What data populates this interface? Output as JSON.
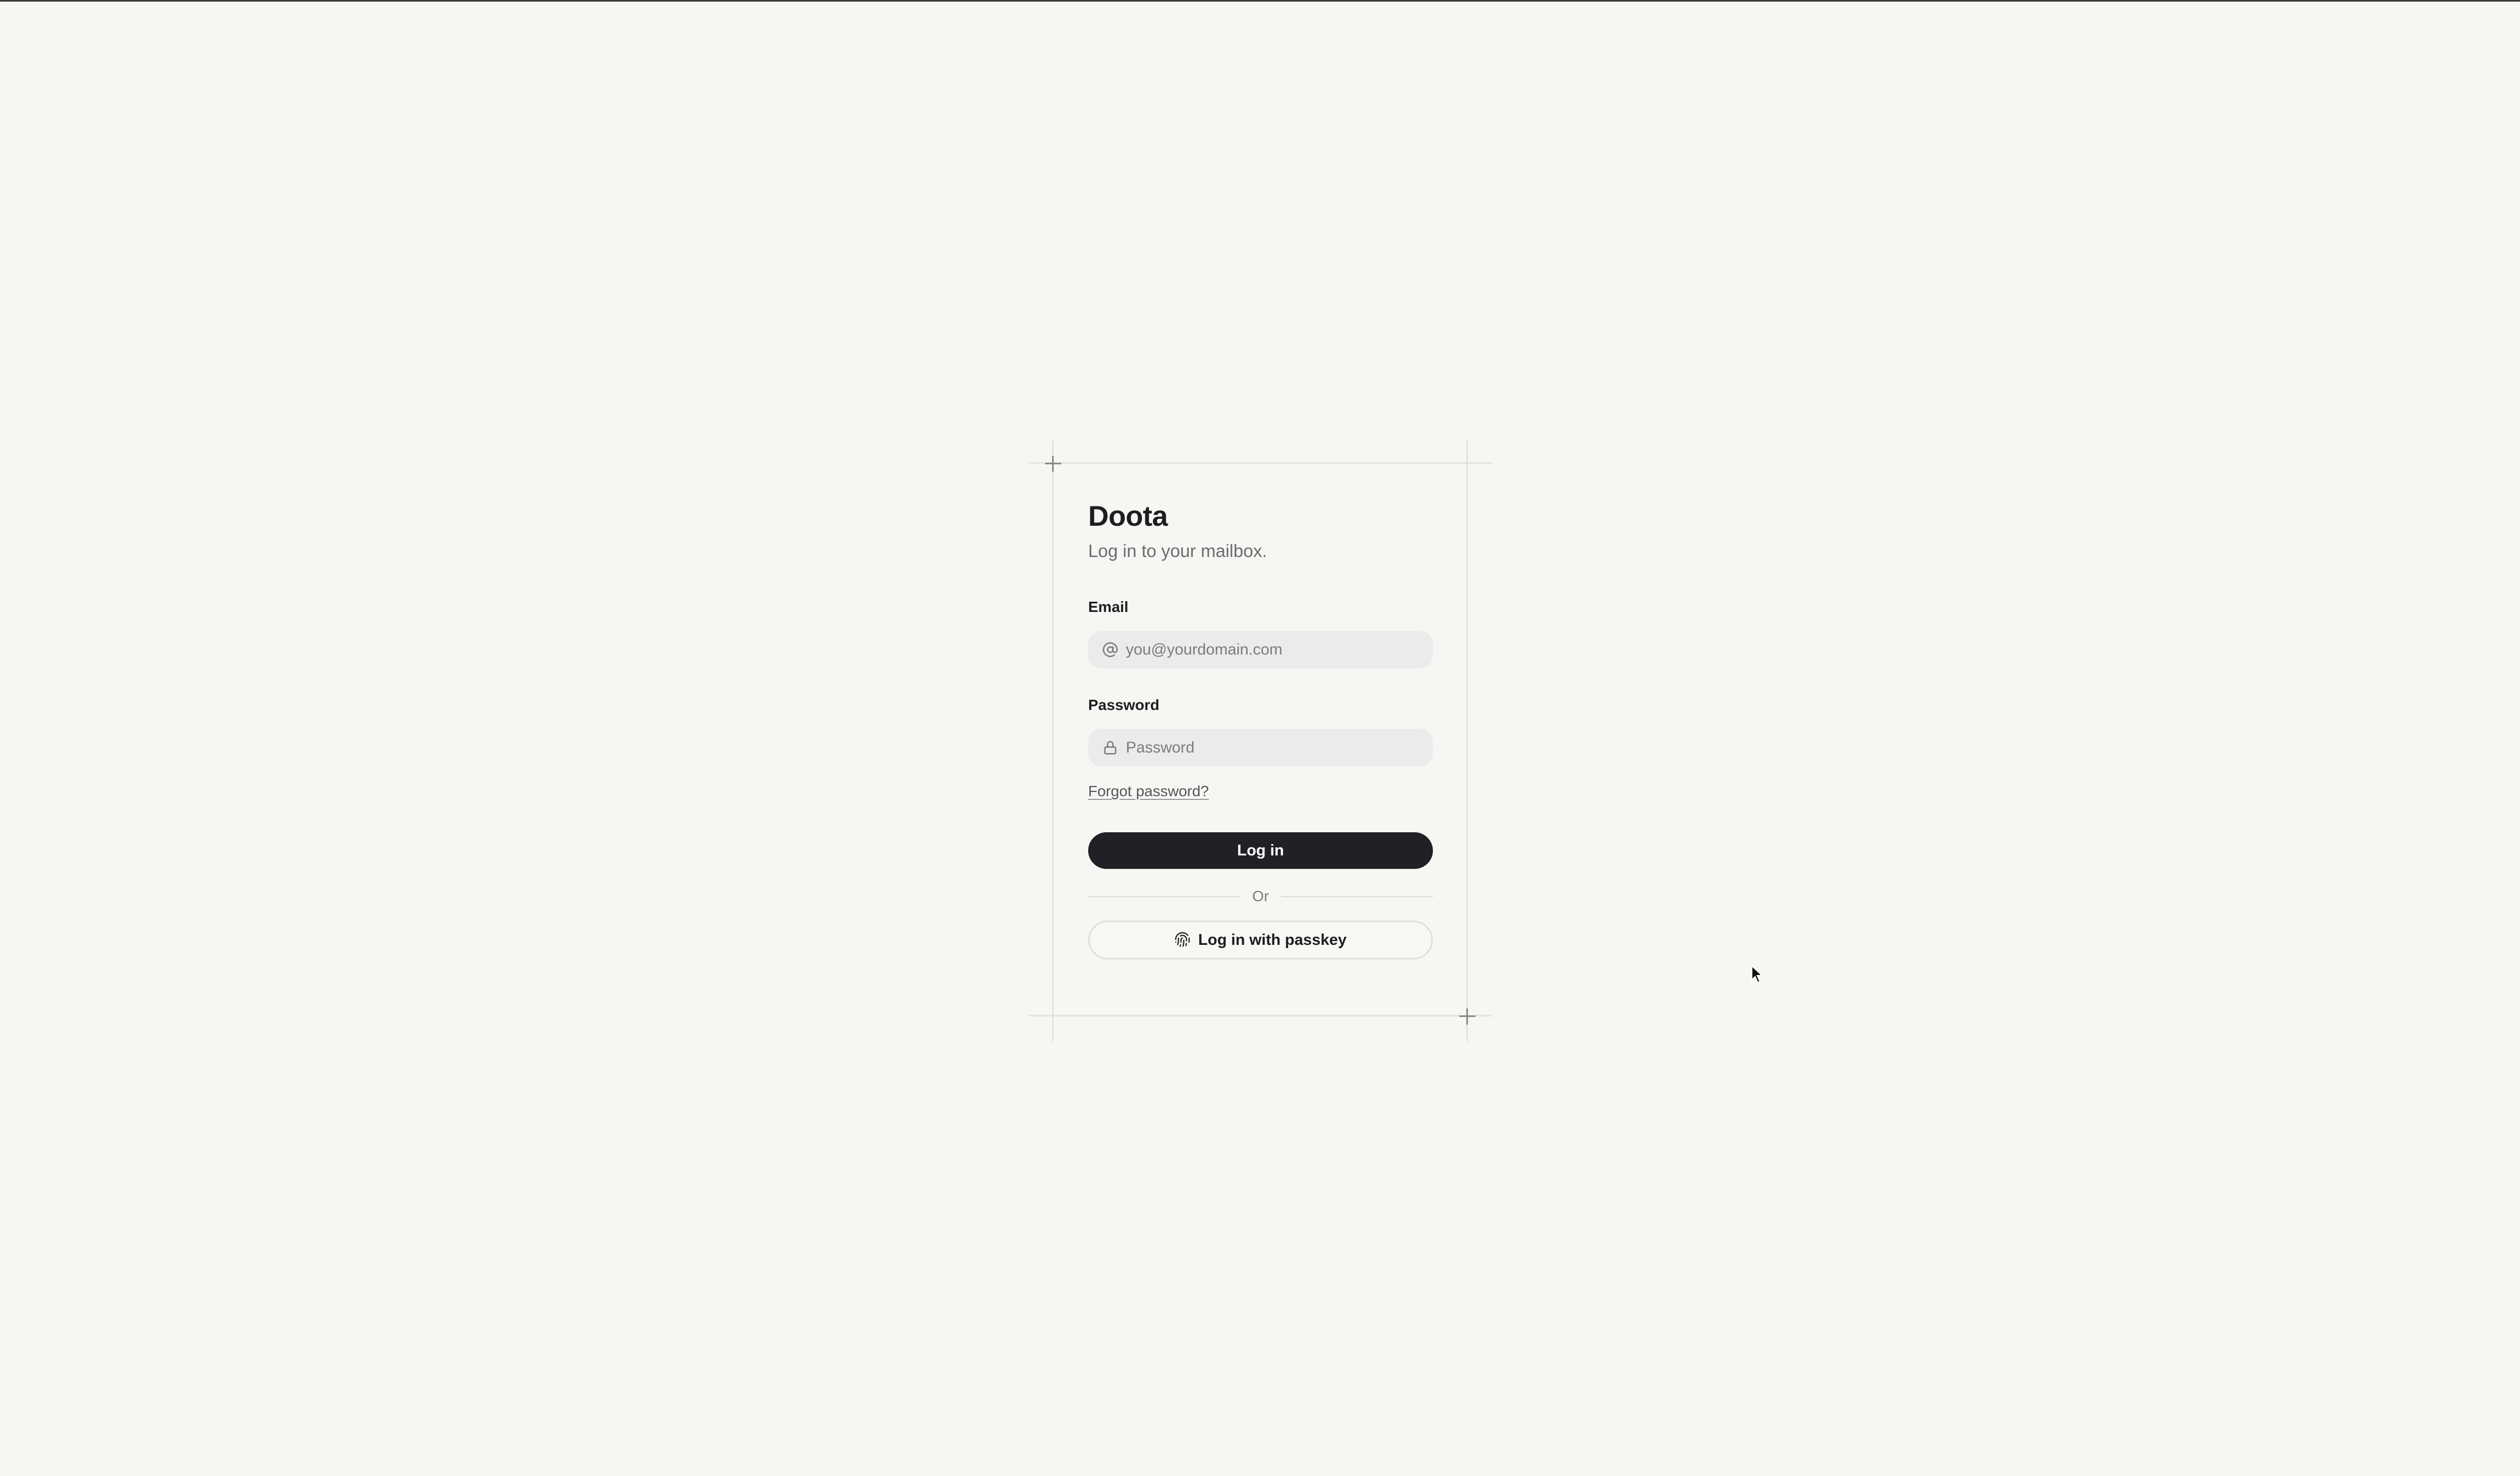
{
  "app": {
    "brand": "Doota",
    "subtitle": "Log in to your mailbox."
  },
  "form": {
    "email": {
      "label": "Email",
      "placeholder": "you@yourdomain.com",
      "icon": "at-icon"
    },
    "password": {
      "label": "Password",
      "placeholder": "Password",
      "icon": "lock-icon"
    },
    "forgot_link": "Forgot password?",
    "login_button": "Log in",
    "divider_text": "Or",
    "passkey_button": "Log in with passkey",
    "passkey_icon": "fingerprint-icon"
  },
  "colors": {
    "background": "#f7f6f3",
    "primary_button": "#202027",
    "input_background": "#ebebeb"
  }
}
